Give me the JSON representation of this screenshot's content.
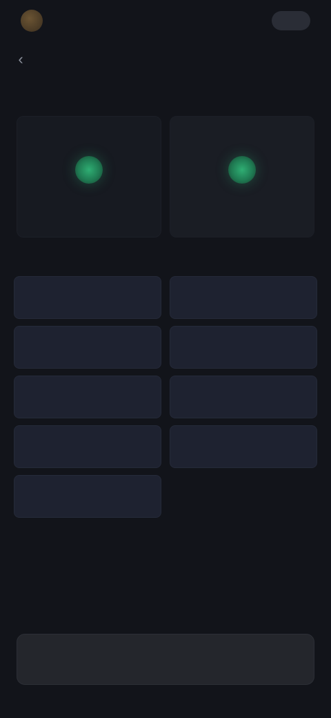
{
  "topbar": {
    "brand_name": "",
    "wallet_text": "",
    "wallet_chip": ""
  },
  "header": {
    "back_icon": "chevron-left-icon",
    "title": ""
  },
  "sections": {
    "network_label": "",
    "tokens_label": ""
  },
  "networks": [
    {
      "label": "",
      "status_color": "#2fae73"
    },
    {
      "label": "",
      "status_color": "#2fae73"
    }
  ],
  "tokens": [
    "",
    "",
    "",
    "",
    "",
    "",
    "",
    "",
    ""
  ],
  "footer": {
    "action_label": ""
  },
  "colors": {
    "background": "#12141a",
    "card": "#171a21",
    "token_button": "#1e2230",
    "status_green": "#2fae73",
    "bottom_button": "#24262c"
  }
}
